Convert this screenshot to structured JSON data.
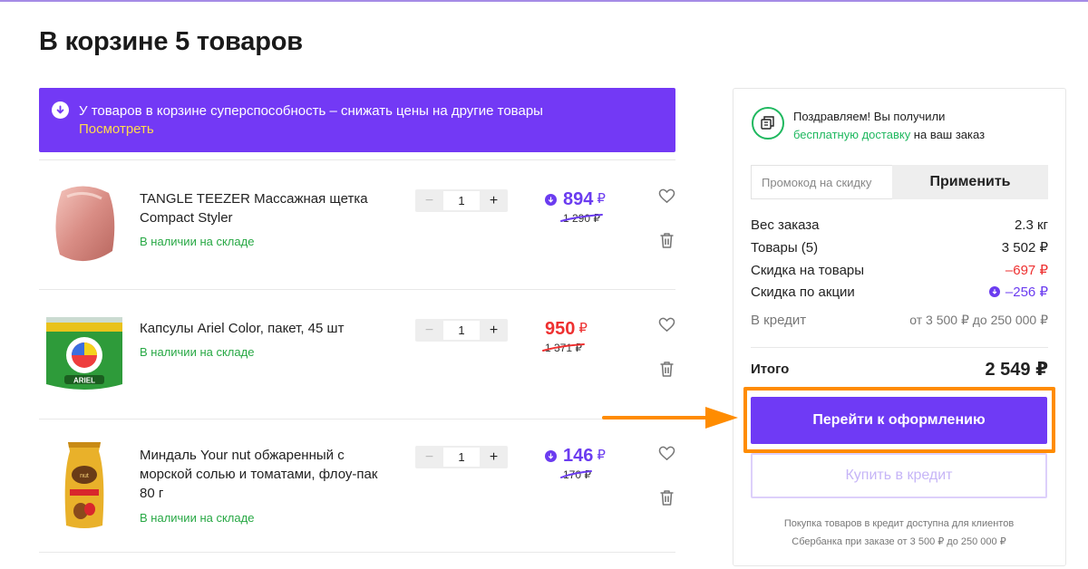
{
  "page": {
    "title": "В корзине 5 товаров"
  },
  "banner": {
    "text": "У товаров в корзине суперспособность – снижать цены на другие товары",
    "link": "Посмотреть"
  },
  "items": [
    {
      "name": "TANGLE TEEZER Массажная щетка Compact Styler",
      "stock": "В наличии на складе",
      "qty": "1",
      "price": "894",
      "old_price": "1 290 ₽",
      "currency": "₽",
      "price_color": "purple",
      "discount_icon": "arrow-down-circle-icon"
    },
    {
      "name": "Капсулы Ariel Color, пакет, 45 шт",
      "stock": "В наличии на складе",
      "qty": "1",
      "price": "950",
      "old_price": "1 371 ₽",
      "currency": "₽",
      "price_color": "red",
      "discount_icon": ""
    },
    {
      "name": "Миндаль Your nut обжаренный с морской солью и томатами, флоу-пак 80 г",
      "stock": "В наличии на складе",
      "qty": "1",
      "price": "146",
      "old_price": "170 ₽",
      "currency": "₽",
      "price_color": "purple",
      "discount_icon": "arrow-down-circle-icon"
    }
  ],
  "qty_controls": {
    "minus": "−",
    "plus": "+"
  },
  "sidebar": {
    "delivery_line1": "Поздравляем! Вы получили",
    "delivery_link": "бесплатную доставку",
    "delivery_line2_suffix": " на ваш заказ",
    "promo_placeholder": "Промокод на скидку",
    "promo_button": "Применить",
    "summary": [
      {
        "label": "Вес заказа",
        "value": "2.3 кг"
      },
      {
        "label": "Товары (5)",
        "value": "3 502 ₽"
      },
      {
        "label": "Скидка на товары",
        "value": "–697 ₽"
      },
      {
        "label": "Скидка по акции",
        "value": "–256 ₽"
      },
      {
        "label": "В кредит",
        "value": "от 3 500 ₽  до 250 000 ₽"
      }
    ],
    "total_label": "Итого",
    "total_value": "2 549 ₽",
    "checkout_button": "Перейти к оформлению",
    "credit_button": "Купить в кредит",
    "credit_note_line1": "Покупка товаров в кредит доступна для клиентов",
    "credit_note_line2": "Сбербанка при заказе от 3 500 ₽ до 250 000 ₽"
  },
  "colors": {
    "accent": "#6f3af5",
    "discount_red": "#ee3030",
    "stock_green": "#27a844",
    "highlight_orange": "#ff8c00"
  }
}
